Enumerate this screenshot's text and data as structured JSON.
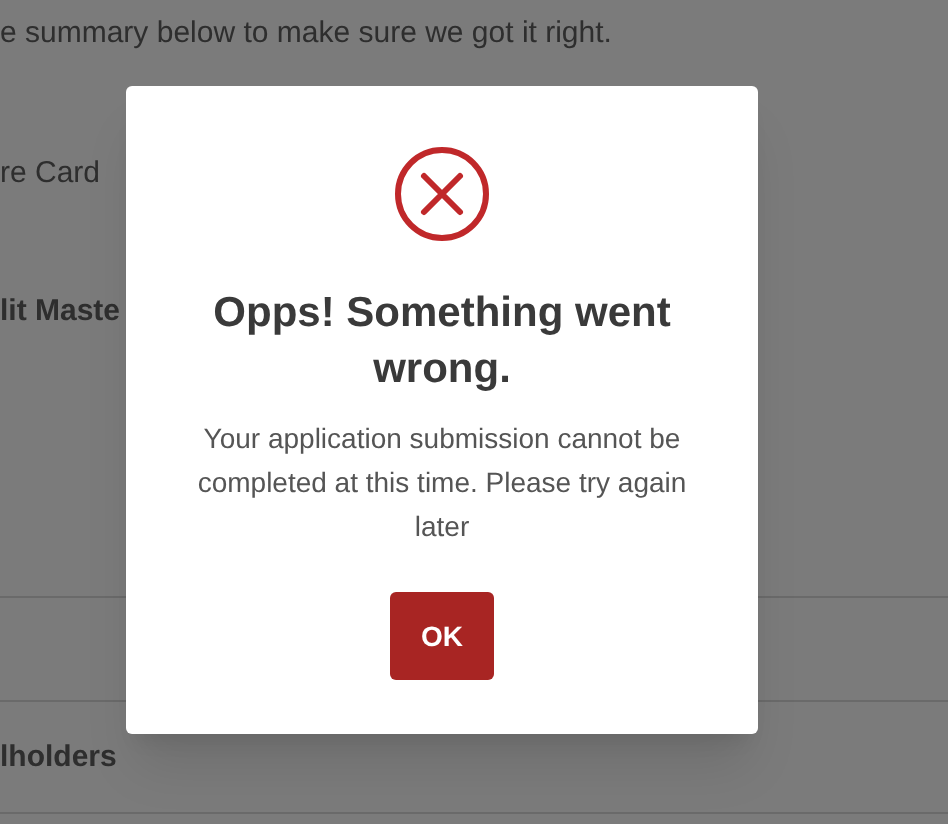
{
  "background": {
    "intro": "e summary below to make sure we got it right.",
    "card_label": "re Card",
    "card_heading": "lit Maste",
    "holders_heading": "lholders"
  },
  "dialog": {
    "title": "Opps! Something went wrong.",
    "message": "Your application submission cannot be completed at this time. Please try again later",
    "button": "OK"
  }
}
